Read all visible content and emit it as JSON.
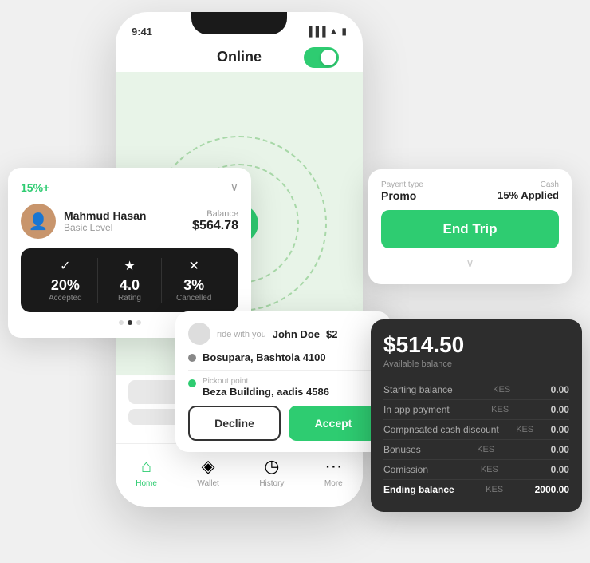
{
  "phone": {
    "status_time": "9:41",
    "online_label": "Online",
    "toggle_on": true
  },
  "driver_card": {
    "promo": "15%+",
    "name": "Mahmud Hasan",
    "level": "Basic Level",
    "balance_label": "Balance",
    "balance": "$564.78",
    "stats": [
      {
        "icon": "✓",
        "value": "20%",
        "label": "Accepted"
      },
      {
        "icon": "★",
        "value": "4.0",
        "label": "Rating"
      },
      {
        "icon": "✕",
        "value": "3%",
        "label": "Cancelled"
      }
    ]
  },
  "ride_request": {
    "passenger": "John Doe",
    "amount": "$2",
    "ride_with_you": "ride with you",
    "from_sublabel": "",
    "from_address": "Bosupara, Bashtola 4100",
    "pickup_sublabel": "Pickout point",
    "pickup_address": "Beza Building, aadis 4586",
    "decline_label": "Decline",
    "accept_label": "Accept"
  },
  "end_trip_card": {
    "payment_type_label": "Payent type",
    "payment_type": "Promo",
    "cash_label": "Cash",
    "promo_applied": "15% Applied",
    "end_trip_label": "End Trip"
  },
  "balance_card": {
    "amount": "$514.50",
    "available_label": "Available balance",
    "rows": [
      {
        "label": "Starting balance",
        "currency": "KES",
        "value": "0.00"
      },
      {
        "label": "In app payment",
        "currency": "KES",
        "value": "0.00"
      },
      {
        "label": "Compnsated cash discount",
        "currency": "KES",
        "value": "0.00"
      },
      {
        "label": "Bonuses",
        "currency": "KES",
        "value": "0.00"
      },
      {
        "label": "Comission",
        "currency": "KES",
        "value": "0.00"
      },
      {
        "label": "Ending balance",
        "currency": "KES",
        "value": "2000.00",
        "ending": true
      }
    ]
  },
  "bottom_nav": [
    {
      "icon": "⌂",
      "label": "Home",
      "active": true
    },
    {
      "icon": "◈",
      "label": "Wallet",
      "active": false
    },
    {
      "icon": "◷",
      "label": "History",
      "active": false
    },
    {
      "icon": "⋯",
      "label": "More",
      "active": false
    }
  ]
}
